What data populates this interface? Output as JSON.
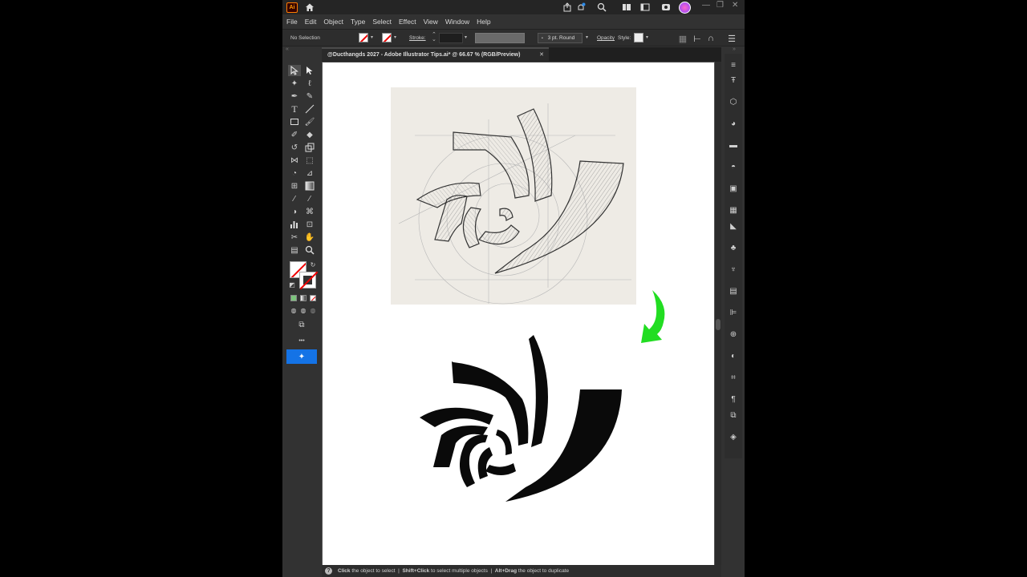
{
  "app": {
    "logo_text": "Ai",
    "accent": "#ff9a00",
    "selection_blue": "#1473e6"
  },
  "titlebar": {
    "icons": [
      "home-icon",
      "share-icon",
      "notifications-icon",
      "search-icon",
      "arrange-documents-icon",
      "workspace-icon",
      "cloud-icon",
      "avatar-icon"
    ]
  },
  "menu": {
    "items": [
      "File",
      "Edit",
      "Object",
      "Type",
      "Select",
      "Effect",
      "View",
      "Window",
      "Help"
    ]
  },
  "control_bar": {
    "selection_label": "No Selection",
    "stroke_label": "Stroke:",
    "brush_label": "3 pt. Round",
    "opacity_label": "Opacity",
    "style_label": "Style:"
  },
  "document": {
    "tab_title": "@Ducthangds 2027 - Adobe Illustrator Tips.ai* @ 66.67 % (RGB/Preview)",
    "close_glyph": "✕"
  },
  "tools": {
    "more_glyph": "•••"
  },
  "status": {
    "help_glyph": "?",
    "hint_1": "Click",
    "hint_1_rest": " the object to select  |  ",
    "hint_2": "Shift+Click",
    "hint_2_rest": " to select multiple objects  |  ",
    "hint_3": "Alt+Drag",
    "hint_3_rest": " the object to duplicate"
  },
  "artwork": {
    "arrow_color": "#22dd22",
    "logo_color": "#0a0a0a"
  }
}
